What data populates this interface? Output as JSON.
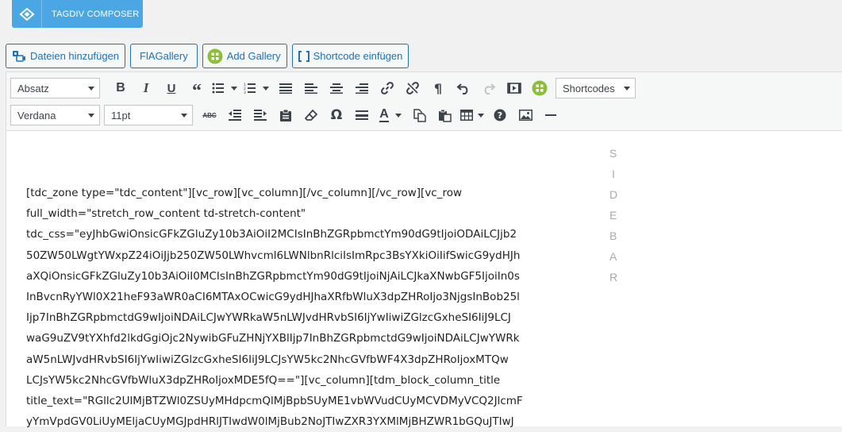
{
  "composer": {
    "label": "TAGDIV COMPOSER"
  },
  "media_buttons": [
    {
      "label": "Dateien hinzufügen"
    },
    {
      "label": "FlAGallery"
    },
    {
      "label": "Add Gallery"
    },
    {
      "label": "Shortcode einfügen"
    }
  ],
  "toolbar": {
    "format_select": "Absatz",
    "shortcodes_select": "Shortcodes",
    "font_select": "Verdana",
    "size_select": "11pt"
  },
  "sidebar_label": [
    "S",
    "I",
    "D",
    "E",
    "B",
    "A",
    "R"
  ],
  "content_lines": [
    "[tdc_zone type=\"tdc_content\"][vc_row][vc_column][/vc_column][/vc_row][vc_row",
    "full_width=\"stretch_row_content td-stretch-content\"",
    "tdc_css=\"eyJhbGwiOnsicGFkZGluZy10b3AiOiI2MCIsInBhZGRpbmctYm90dG9tIjoiODAiLCJjb2",
    "50ZW50LWgtYWxpZ24iOiJjb250ZW50LWhvcml6LWNlbnRlciIsImRpc3BsYXkiOiIifSwicG9ydHJh",
    "aXQiOnsicGFkZGluZy10b3AiOiI0MCIsInBhZGRpbmctYm90dG9tIjoiNjAiLCJkaXNwbGF5IjoiIn0s",
    "InBvcnRyYWl0X21heF93aWR0aCI6MTAxOCwicG9ydHJhaXRfbWluX3dpZHRoIjo3NjgsInBob25l",
    "Ijp7InBhZGRpbmctdG9wIjoiNDAiLCJwYWRkaW5nLWJvdHRvbSI6IjYwIiwiZGlzcGxheSI6IiJ9LCJ",
    "waG9uZV9tYXhfd2lkdGgiOjc2NywibGFuZHNjYXBlIjp7InBhZGRpbmctdG9wIjoiNDAiLCJwYWRk",
    "aW5nLWJvdHRvbSI6IjYwIiwiZGlzcGxheSI6IiJ9LCJsYW5kc2NhcGVfbWF4X3dpZHRoIjoxMTQw",
    "LCJsYW5kc2NhcGVfbWluX3dpZHRoIjoxMDE5fQ==\"][vc_column][tdm_block_column_title",
    "title_text=\"RGllc2UlMjBTZWl0ZSUyMHdpcmQlMjBpbSUyME1vbWVudCUyMCVDMyVCQ2JlcmF",
    "yYmVpdGV0LiUyMEljaCUyMGJpdHRlJTIwdW0lMjBub2NoJTIwZXR3YXMlMjBHZWR1bGQuJTIwJ"
  ]
}
